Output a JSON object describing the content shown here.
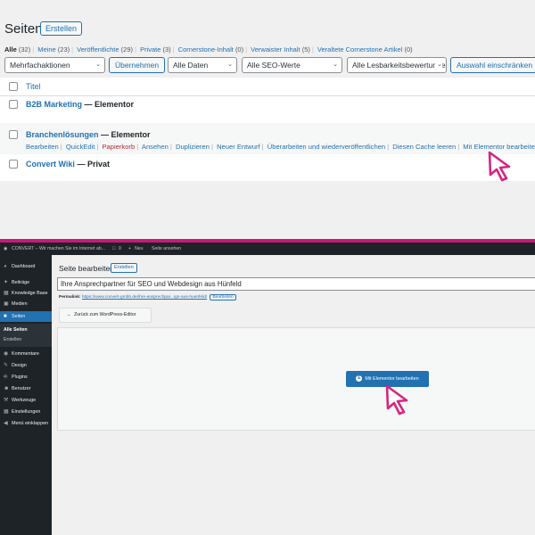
{
  "top": {
    "title": "Seiten",
    "create_label": "Erstellen",
    "filters": [
      {
        "label": "Alle",
        "count": "(32)"
      },
      {
        "label": "Meine",
        "count": "(23)"
      },
      {
        "label": "Veröffentlichte",
        "count": "(29)"
      },
      {
        "label": "Private",
        "count": "(3)"
      },
      {
        "label": "Cornerstone-Inhalt",
        "count": "(0)"
      },
      {
        "label": "Verwaister Inhalt",
        "count": "(5)"
      },
      {
        "label": "Veraltete Cornerstone Artikel",
        "count": "(0)"
      }
    ],
    "bulk_select": "Mehrfachaktionen",
    "apply_label": "Übernehmen",
    "date_select": "Alle Daten",
    "seo_select": "Alle SEO-Werte",
    "readability_select": "Alle Lesbarkeitsbewertungen",
    "filter_label": "Auswahl einschränken",
    "col_title": "Titel",
    "rows": [
      {
        "name": "B2B Marketing",
        "state": "— Elementor"
      },
      {
        "name": "Branchenlösungen",
        "state": "— Elementor"
      },
      {
        "name": "Convert Wiki",
        "state": "— Privat"
      }
    ],
    "row_actions": [
      "Bearbeiten",
      "QuickEdit",
      "Papierkorb",
      "Ansehen",
      "Duplizieren",
      "Neuer Entwurf",
      "Überarbeiten und wiederveröffentlichen",
      "Diesen Cache leeren",
      "Mit Elementor bearbeiten"
    ]
  },
  "adminbar": {
    "site": "CONVERT – Wir machen Sie im Internet ab...",
    "comments": "0",
    "new_label": "Neu",
    "view_label": "Seite ansehen"
  },
  "sidebar": {
    "items": [
      {
        "label": "Dashboard",
        "icon": "dashboard-icon"
      },
      {
        "label": "Beiträge",
        "icon": "pin-icon"
      },
      {
        "label": "Knowledge Base",
        "icon": "book-icon"
      },
      {
        "label": "Medien",
        "icon": "media-icon"
      },
      {
        "label": "Seiten",
        "icon": "page-icon"
      },
      {
        "label": "Kommentare",
        "icon": "comment-icon"
      },
      {
        "label": "Design",
        "icon": "brush-icon"
      },
      {
        "label": "Plugins",
        "icon": "plugin-icon"
      },
      {
        "label": "Benutzer",
        "icon": "user-icon"
      },
      {
        "label": "Werkzeuge",
        "icon": "wrench-icon"
      },
      {
        "label": "Einstellungen",
        "icon": "settings-icon"
      },
      {
        "label": "Menü einklappen",
        "icon": "collapse-icon"
      }
    ],
    "sub_items": [
      "Alle Seiten",
      "Erstellen"
    ]
  },
  "editor": {
    "title": "Seite bearbeiten",
    "create_label": "Erstellen",
    "post_title": "Ihre Ansprechpartner für SEO und Webdesign aus Hünfeld",
    "permalink_label": "Permalink:",
    "permalink_url": "https://www.convert-gmbh.de/ihre-ansprechpar...ign-aus-huenfeld/",
    "permalink_edit": "Bearbeiten",
    "back_label": "Zurück zum WordPress-Editor",
    "elementor_label": "Mit Elementor bearbeiten"
  },
  "colors": {
    "accent": "#2271b1",
    "divider": "#c6197c",
    "cursor": "#d4267f",
    "adminbar": "#1d2327"
  }
}
